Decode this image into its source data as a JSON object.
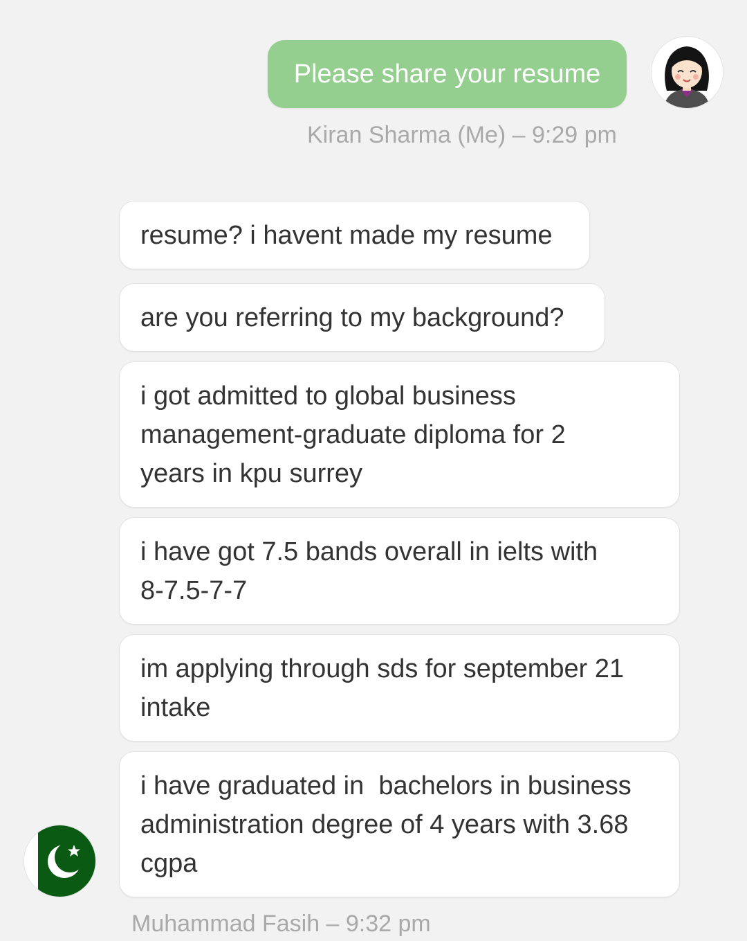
{
  "sent": {
    "message": "Please share your resume",
    "meta": "Kiran Sharma (Me) – 9:29 pm",
    "avatar_icon": "woman-avatar-icon"
  },
  "received": {
    "messages": [
      "resume? i havent made my resume",
      "are you referring to my background?",
      "i got admitted to global business\nmanagement-graduate diploma for 2\nyears in kpu surrey",
      "i have got 7.5 bands overall in ielts with\n8-7.5-7-7",
      "im applying through sds for september 21\nintake",
      "i have graduated in  bachelors in business\nadministration degree of 4 years with 3.68\ncgpa"
    ],
    "meta": "Muhammad Fasih – 9:32 pm",
    "avatar_icon": "pakistan-flag-icon"
  },
  "colors": {
    "background": "#f2f2f2",
    "sent_bubble": "#94cf8f",
    "received_bubble": "#ffffff",
    "meta_text": "#a9a9a9",
    "flag_green": "#0b5a14"
  }
}
